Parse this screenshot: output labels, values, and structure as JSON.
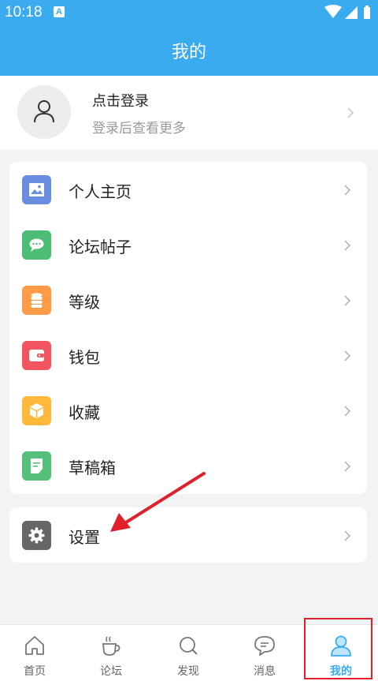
{
  "status_bar": {
    "time": "10:18",
    "notification_icon": "A"
  },
  "header": {
    "title": "我的"
  },
  "profile": {
    "title": "点击登录",
    "subtitle": "登录后查看更多"
  },
  "menu": {
    "items": [
      {
        "label": "个人主页",
        "icon": "image-icon",
        "color": "#6b8de0"
      },
      {
        "label": "论坛帖子",
        "icon": "chat-icon",
        "color": "#4cbd74"
      },
      {
        "label": "等级",
        "icon": "coins-icon",
        "color": "#ff9a47"
      },
      {
        "label": "钱包",
        "icon": "wallet-icon",
        "color": "#f25560"
      },
      {
        "label": "收藏",
        "icon": "box-icon",
        "color": "#ffb83a"
      },
      {
        "label": "草稿箱",
        "icon": "draft-icon",
        "color": "#55c07a"
      }
    ],
    "settings": {
      "label": "设置",
      "icon": "gear-icon",
      "color": "#666666"
    }
  },
  "tabs": [
    {
      "label": "首页",
      "icon": "home-icon"
    },
    {
      "label": "论坛",
      "icon": "coffee-icon"
    },
    {
      "label": "发现",
      "icon": "search-icon"
    },
    {
      "label": "消息",
      "icon": "message-icon"
    },
    {
      "label": "我的",
      "icon": "user-icon",
      "active": true
    }
  ],
  "colors": {
    "brand": "#3aabef",
    "highlight_box": "#e0202a",
    "annotation_arrow": "#e0202a"
  }
}
